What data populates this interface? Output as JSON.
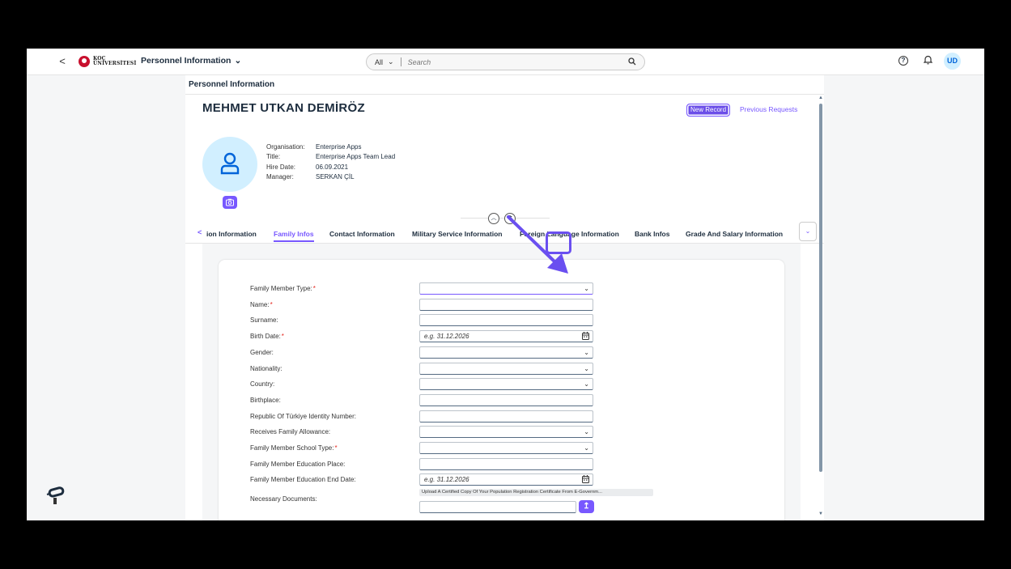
{
  "shell": {
    "back": "<",
    "logo_text_1": "KOÇ",
    "logo_text_2": "ÜNİVERSİTESİ",
    "title": "Personnel Information",
    "search_scope": "All",
    "search_placeholder": "Search",
    "avatar_initials": "UD"
  },
  "page": {
    "title": "Personnel Information",
    "employee_name": "MEHMET UTKAN DEMİRÖZ",
    "new_record": "New Record",
    "previous_requests": "Previous Requests",
    "info": [
      {
        "label": "Organisation:",
        "value": "Enterprise Apps"
      },
      {
        "label": "Title:",
        "value": "Enterprise Apps Team Lead"
      },
      {
        "label": "Hire Date:",
        "value": "06.09.2021"
      },
      {
        "label": "Manager:",
        "value": "SERKAN ÇİL"
      }
    ]
  },
  "tabs": [
    {
      "label": "ion Information",
      "active": false
    },
    {
      "label": "Family Infos",
      "active": true
    },
    {
      "label": "Contact Information",
      "active": false
    },
    {
      "label": "Military Service Information",
      "active": false
    },
    {
      "label": "Foreign Language Information",
      "active": false
    },
    {
      "label": "Bank Infos",
      "active": false
    },
    {
      "label": "Grade And Salary Information",
      "active": false
    }
  ],
  "form": {
    "fields": [
      {
        "label": "Family Member Type:",
        "required": true,
        "type": "select",
        "value": ""
      },
      {
        "label": "Name:",
        "required": true,
        "type": "text",
        "value": ""
      },
      {
        "label": "Surname:",
        "required": false,
        "type": "text",
        "value": ""
      },
      {
        "label": "Birth Date:",
        "required": true,
        "type": "date",
        "value": "e.g. 31.12.2026"
      },
      {
        "label": "Gender:",
        "required": false,
        "type": "select",
        "value": ""
      },
      {
        "label": "Nationality:",
        "required": false,
        "type": "select",
        "value": ""
      },
      {
        "label": "Country:",
        "required": false,
        "type": "select",
        "value": ""
      },
      {
        "label": "Birthplace:",
        "required": false,
        "type": "text",
        "value": ""
      },
      {
        "label": "Republic Of Türkiye Identity Number:",
        "required": false,
        "type": "text",
        "value": ""
      },
      {
        "label": "Receives Family Allowance:",
        "required": false,
        "type": "select",
        "value": ""
      },
      {
        "label": "Family Member School Type:",
        "required": true,
        "type": "select",
        "value": ""
      },
      {
        "label": "Family Member Education Place:",
        "required": false,
        "type": "text",
        "value": ""
      },
      {
        "label": "Family Member Education End Date:",
        "required": false,
        "type": "date",
        "value": "e.g. 31.12.2026"
      }
    ],
    "documents_label": "Necessary Documents:",
    "upload_note": "Upload A Certified Copy Of Your Population Registration Certificate From E-Governm..."
  },
  "colors": {
    "accent": "#7858ff",
    "annotation": "#6a4ff0",
    "required": "#e4271e"
  }
}
